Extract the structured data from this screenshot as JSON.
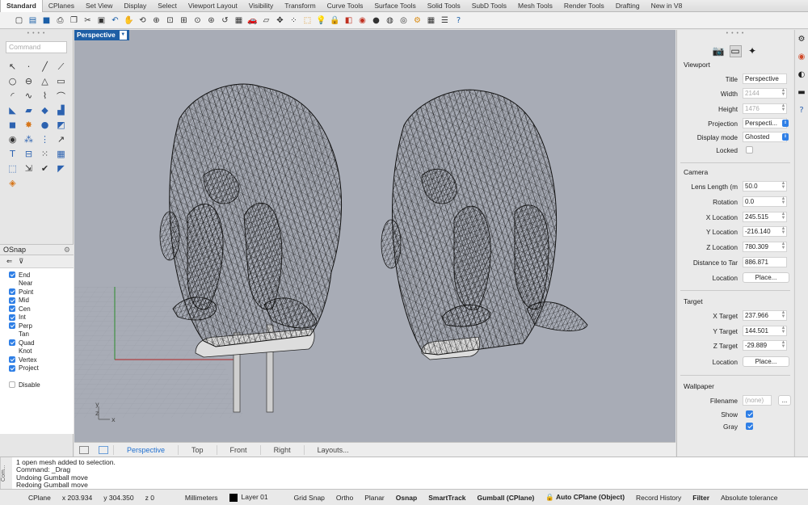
{
  "tabs": [
    "Standard",
    "CPlanes",
    "Set View",
    "Display",
    "Select",
    "Viewport Layout",
    "Visibility",
    "Transform",
    "Curve Tools",
    "Surface Tools",
    "Solid Tools",
    "SubD Tools",
    "Mesh Tools",
    "Render Tools",
    "Drafting",
    "New in V8"
  ],
  "active_tab": "Standard",
  "command": {
    "placeholder": "Command"
  },
  "viewport": {
    "title": "Perspective",
    "axis": {
      "y": "y",
      "z": "z",
      "x": "x"
    }
  },
  "osnap": {
    "title": "OSnap",
    "items": [
      {
        "label": "End",
        "checked": true
      },
      {
        "label": "Near",
        "checked": false
      },
      {
        "label": "Point",
        "checked": true
      },
      {
        "label": "Mid",
        "checked": true
      },
      {
        "label": "Cen",
        "checked": true
      },
      {
        "label": "Int",
        "checked": true
      },
      {
        "label": "Perp",
        "checked": true
      },
      {
        "label": "Tan",
        "checked": false
      },
      {
        "label": "Quad",
        "checked": true
      },
      {
        "label": "Knot",
        "checked": false
      },
      {
        "label": "Vertex",
        "checked": true
      },
      {
        "label": "Project",
        "checked": true
      }
    ],
    "disable_label": "Disable"
  },
  "viewport_tabs": [
    "Perspective",
    "Top",
    "Front",
    "Right",
    "Layouts..."
  ],
  "properties": {
    "viewport_section": "Viewport",
    "title_label": "Title",
    "title_value": "Perspective",
    "width_label": "Width",
    "width_value": "2144",
    "height_label": "Height",
    "height_value": "1476",
    "projection_label": "Projection",
    "projection_value": "Perspecti...",
    "display_mode_label": "Display mode",
    "display_mode_value": "Ghosted",
    "locked_label": "Locked",
    "camera_section": "Camera",
    "lens_label": "Lens Length (m",
    "lens_value": "50.0",
    "rotation_label": "Rotation",
    "rotation_value": "0.0",
    "xloc_label": "X Location",
    "xloc_value": "245.515",
    "yloc_label": "Y Location",
    "yloc_value": "-216.140",
    "zloc_label": "Z Location",
    "zloc_value": "780.309",
    "dist_label": "Distance to Tar",
    "dist_value": "886.871",
    "location_label": "Location",
    "place_label": "Place...",
    "target_section": "Target",
    "xt_label": "X Target",
    "xt_value": "237.966",
    "yt_label": "Y Target",
    "yt_value": "144.501",
    "zt_label": "Z Target",
    "zt_value": "-29.889",
    "wallpaper_section": "Wallpaper",
    "filename_label": "Filename",
    "filename_value": "(none)",
    "browse_label": "...",
    "show_label": "Show",
    "gray_label": "Gray"
  },
  "history": {
    "side_label": "Com...",
    "lines": [
      "1 open mesh added to selection.",
      "Command: _Drag",
      "Undoing Gumball move",
      "Redoing Gumball move"
    ]
  },
  "status": {
    "cplane": "CPlane",
    "x": "x 203.934",
    "y": "y 304.350",
    "z": "z 0",
    "units": "Millimeters",
    "layer": "Layer 01",
    "grid_snap": "Grid Snap",
    "ortho": "Ortho",
    "planar": "Planar",
    "osnap": "Osnap",
    "smarttrack": "SmartTrack",
    "gumball": "Gumball (CPlane)",
    "auto_cplane": "Auto CPlane (Object)",
    "record_history": "Record History",
    "filter": "Filter",
    "abs_tol": "Absolute tolerance"
  },
  "colors": {
    "accent": "#2f7fe6",
    "viewport_bg": "#a8acb6",
    "label_bg": "#1f5fa5"
  }
}
